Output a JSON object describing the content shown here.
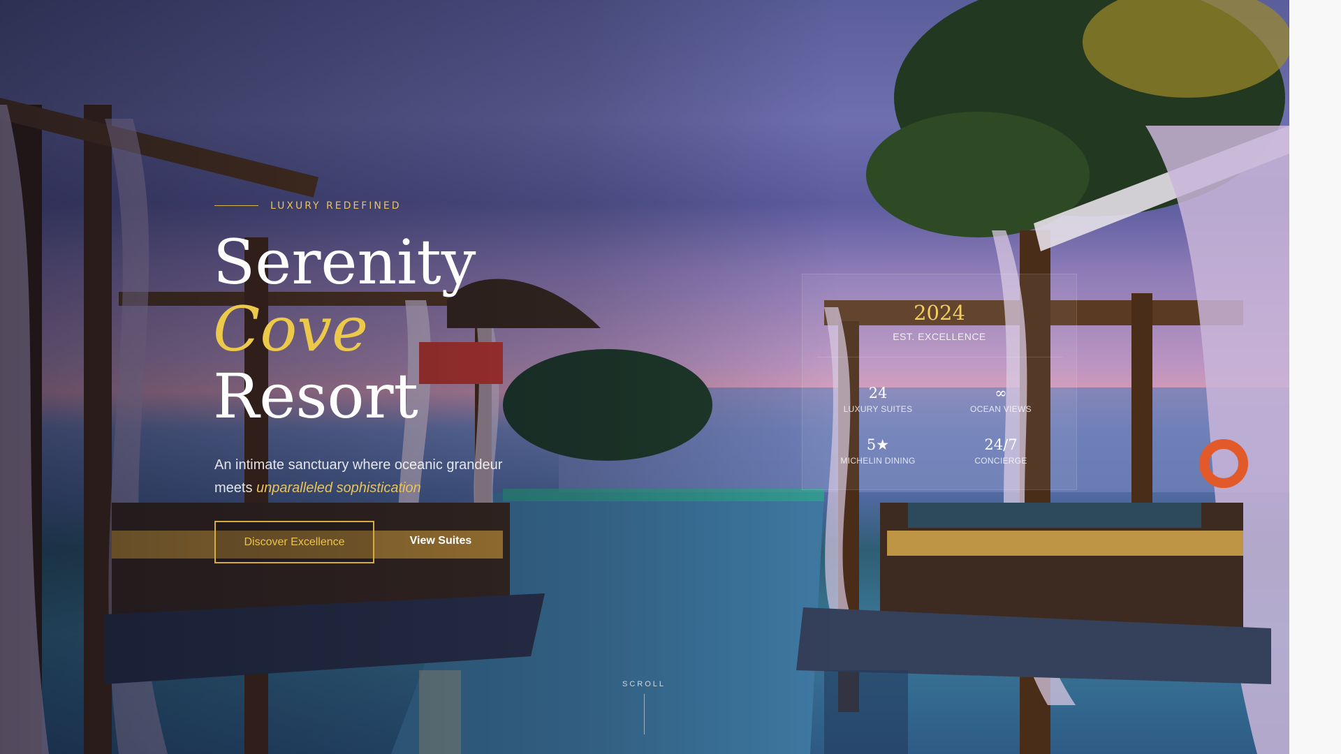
{
  "hero": {
    "eyebrow": "LUXURY REDEFINED",
    "title_line1": "Serenity",
    "title_line2": "Cove",
    "title_line3": "Resort",
    "lead_text": "An intimate sanctuary where oceanic grandeur meets",
    "lead_emphasis": "unparalleled sophistication",
    "primary_cta": "Discover Excellence",
    "secondary_cta": "View Suites",
    "scroll_label": "SCROLL",
    "accent_color": "#ecc94b"
  },
  "stats": {
    "year": "2024",
    "year_label": "EST. EXCELLENCE",
    "items": [
      {
        "value": "24",
        "label": "LUXURY SUITES"
      },
      {
        "value": "∞",
        "label": "OCEAN VIEWS"
      },
      {
        "value": "5★",
        "label": "MICHELIN DINING"
      },
      {
        "value": "24/7",
        "label": "CONCIERGE"
      }
    ]
  }
}
